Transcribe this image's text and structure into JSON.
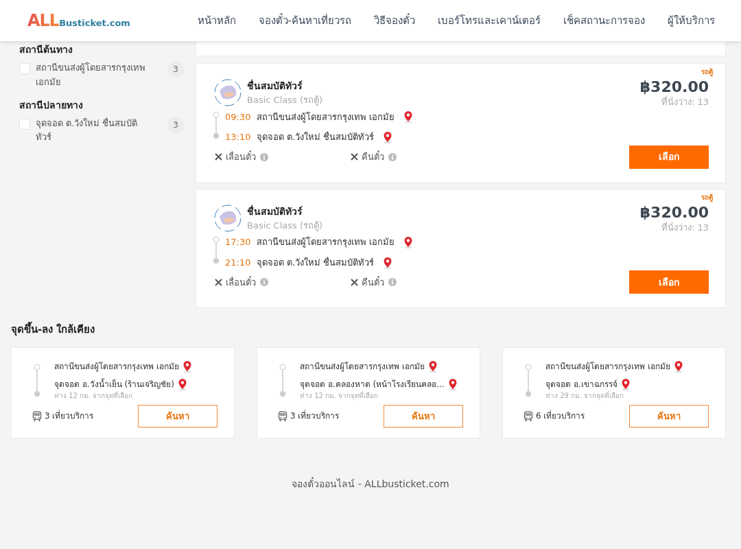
{
  "logo": {
    "brand": "ALL",
    "domain": "Busticket.com"
  },
  "nav": [
    {
      "label": "หน้าหลัก"
    },
    {
      "label": "จองตั๋ว-ค้นหาเที่ยวรถ"
    },
    {
      "label": "วิธีจองตั๋ว"
    },
    {
      "label": "เบอร์โทรและเคาน์เตอร์"
    },
    {
      "label": "เช็คสถานะการจอง"
    },
    {
      "label": "ผู้ให้บริการ"
    }
  ],
  "filters": [
    {
      "title": "สถานีต้นทาง",
      "options": [
        {
          "label": "สถานีขนส่งผู้โดยสารกรุงเทพ เอกมัย",
          "count": "3",
          "checked": false
        }
      ]
    },
    {
      "title": "สถานีปลายทาง",
      "options": [
        {
          "label": "จุดจอด ต.วังใหม่ ชื่นสมบัติทัวร์",
          "count": "3",
          "checked": false
        }
      ]
    }
  ],
  "trips": [
    {
      "vehicle_tag": "รถตู้",
      "operator": "ชื่นสมบัติทัวร์",
      "class": "Basic Class (รถตู้)",
      "price": "฿320.00",
      "seats": "ที่นั่งว่าง: 13",
      "departure": {
        "time": "09:30",
        "place": "สถานีขนส่งผู้โดยสารกรุงเทพ เอกมัย"
      },
      "arrival": {
        "time": "13:10",
        "place": "จุดจอด ต.วังใหม่ ชื่นสมบัติทัวร์"
      },
      "policies": [
        {
          "label": "เลื่อนตั๋ว",
          "allowed": false
        },
        {
          "label": "คืนตั๋ว",
          "allowed": false
        }
      ],
      "button": "เลือก"
    },
    {
      "vehicle_tag": "รถตู้",
      "operator": "ชื่นสมบัติทัวร์",
      "class": "Basic Class (รถตู้)",
      "price": "฿320.00",
      "seats": "ที่นั่งว่าง: 13",
      "departure": {
        "time": "17:30",
        "place": "สถานีขนส่งผู้โดยสารกรุงเทพ เอกมัย"
      },
      "arrival": {
        "time": "21:10",
        "place": "จุดจอด ต.วังใหม่ ชื่นสมบัติทัวร์"
      },
      "policies": [
        {
          "label": "เลื่อนตั๋ว",
          "allowed": false
        },
        {
          "label": "คืนตั๋ว",
          "allowed": false
        }
      ],
      "button": "เลือก"
    }
  ],
  "nearby": {
    "title": "จุดขึ้น-ลง ใกล้เคียง",
    "routes": [
      {
        "from": "สถานีขนส่งผู้โดยสารกรุงเทพ เอกมัย",
        "to": "จุดจอด อ.วังน้ำเย็น (ร้านเจริญชัย)",
        "distance": "ห่าง 12 กม. จากจุดที่เลือก",
        "trips": "3 เที่ยวบริการ",
        "button": "ค้นหา"
      },
      {
        "from": "สถานีขนส่งผู้โดยสารกรุงเทพ เอกมัย",
        "to": "จุดจอด อ.คลองหาด (หน้าโรงเรียนคลอ...",
        "distance": "ห่าง 12 กม. จากจุดที่เลือก",
        "trips": "3 เที่ยวบริการ",
        "button": "ค้นหา"
      },
      {
        "from": "สถานีขนส่งผู้โดยสารกรุงเทพ เอกมัย",
        "to": "จุดจอด อ.เขาฉกรรจ์",
        "distance": "ห่าง 29 กม. จากจุดที่เลือก",
        "trips": "6 เที่ยวบริการ",
        "button": "ค้นหา"
      }
    ]
  },
  "footer": "จองตั๋วออนไลน์ - ALLbusticket.com"
}
